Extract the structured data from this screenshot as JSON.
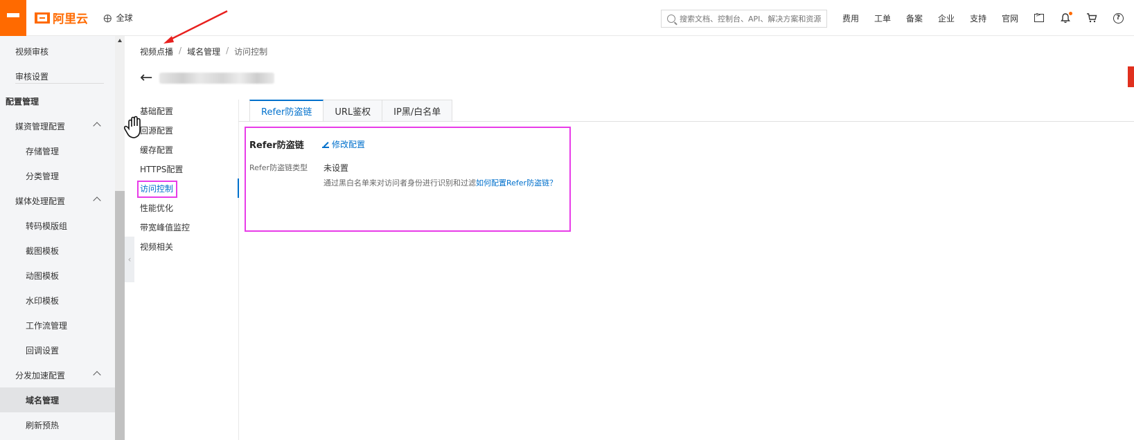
{
  "topbar": {
    "brand": "阿里云",
    "region": "全球",
    "search_placeholder": "搜索文档、控制台、API、解决方案和资源",
    "nav": [
      "费用",
      "工单",
      "备案",
      "企业",
      "支持",
      "官网"
    ],
    "icons": [
      "terminal-icon",
      "bell-icon",
      "cart-icon",
      "help-icon"
    ],
    "accent_color": "#ff6a00"
  },
  "sidebar": {
    "items": [
      {
        "label": "视频审核",
        "level": 1
      },
      {
        "label": "审核设置",
        "level": 1
      },
      {
        "label": "配置管理",
        "level": 0
      },
      {
        "label": "媒资管理配置",
        "level": 1,
        "expandable": true
      },
      {
        "label": "存储管理",
        "level": 2
      },
      {
        "label": "分类管理",
        "level": 2
      },
      {
        "label": "媒体处理配置",
        "level": 1,
        "expandable": true
      },
      {
        "label": "转码模版组",
        "level": 2
      },
      {
        "label": "截图模板",
        "level": 2
      },
      {
        "label": "动图模板",
        "level": 2
      },
      {
        "label": "水印模板",
        "level": 2
      },
      {
        "label": "工作流管理",
        "level": 2
      },
      {
        "label": "回调设置",
        "level": 2
      },
      {
        "label": "分发加速配置",
        "level": 1,
        "expandable": true
      },
      {
        "label": "域名管理",
        "level": 2,
        "active": true
      },
      {
        "label": "刷新预热",
        "level": 2
      }
    ]
  },
  "breadcrumb": [
    "视频点播",
    "域名管理",
    "访问控制"
  ],
  "subnav": {
    "items": [
      "基础配置",
      "回源配置",
      "缓存配置",
      "HTTPS配置",
      "访问控制",
      "性能优化",
      "带宽峰值监控",
      "视频相关"
    ],
    "selected": "访问控制"
  },
  "tabs": [
    "Refer防盗链",
    "URL鉴权",
    "IP黑/白名单"
  ],
  "panel": {
    "title": "Refer防盗链",
    "edit_label": "修改配置",
    "field_label": "Refer防盗链类型",
    "field_value": "未设置",
    "desc_text": "通过黑白名单来对访问者身份进行识别和过滤",
    "desc_link": "如何配置Refer防盗链？"
  },
  "colors": {
    "link": "#0070cc",
    "highlight": "#e83be8",
    "annotation_arrow": "#e8201e"
  }
}
